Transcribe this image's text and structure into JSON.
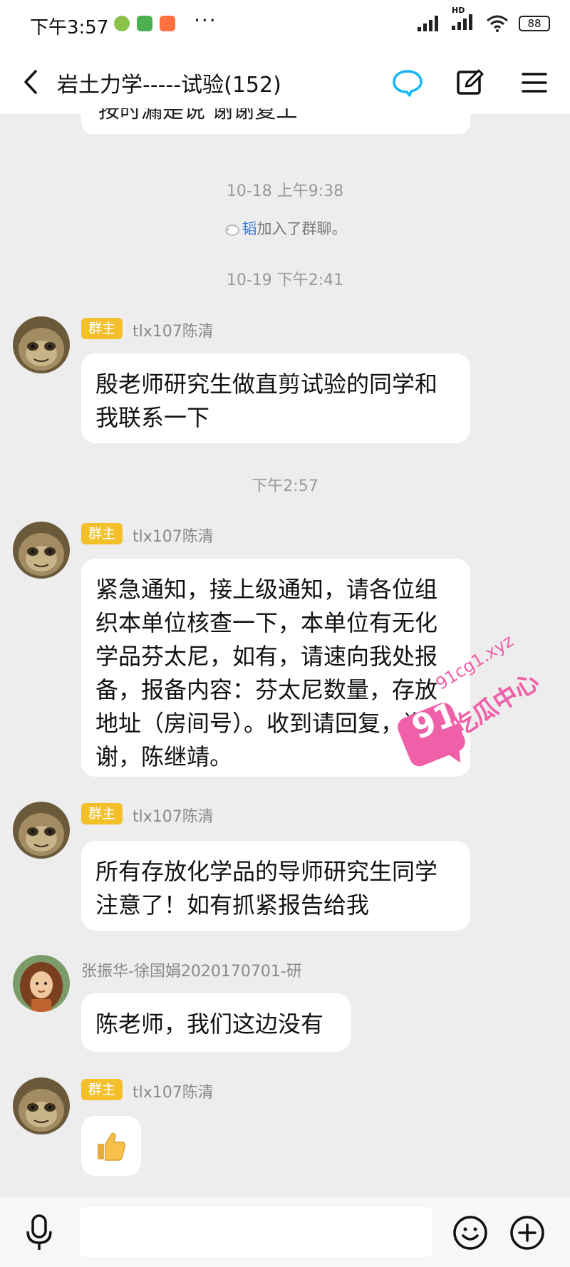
{
  "status_bar": {
    "time": "下午3:57",
    "dots": "···",
    "battery": "88",
    "network": "HD"
  },
  "header": {
    "title": "岩土力学-----试验(152)",
    "accent_color": "#12b7f5"
  },
  "messages": {
    "prev_bubble_tail": "按时漏是说 谢谢复工",
    "ts1": "10-18 上午9:38",
    "join_name": "韬",
    "join_text": "加入了群聊。",
    "ts2": "10-19 下午2:41",
    "owner_badge": "群主",
    "owner_name": "tlx107陈清",
    "msg1_line1": "殷老师研究生做直剪试验的同学和",
    "msg1_line2": "我联系一下",
    "ts3": "下午2:57",
    "msg2_lines": [
      "紧急通知，接上级通知，请各位组",
      "织本单位核查一下，本单位有无化",
      "学品芬太尼，如有，请速向我处报",
      "备，报备内容：芬太尼数量，存放",
      "地址（房间号）。收到请回复，谢",
      "谢，陈继靖。"
    ],
    "msg3_line1": "所有存放化学品的导师研究生同学",
    "msg3_line2": "注意了！如有抓紧报告给我",
    "member_name": "张振华-徐国娟2020170701-研",
    "msg4": "陈老师，我们这边没有",
    "msg5_emoji": "👍"
  },
  "watermark": {
    "number": "91",
    "domain": "91cg1.xyz",
    "brand": "吃瓜中心",
    "color": "#f060a8"
  },
  "colors": {
    "badge": "#f3c02c",
    "background": "#ededed",
    "link": "#3b7ad9"
  },
  "icons": [
    "back-icon",
    "chat-bubble-icon",
    "edit-icon",
    "menu-icon",
    "mic-icon",
    "emoji-icon",
    "add-icon"
  ]
}
